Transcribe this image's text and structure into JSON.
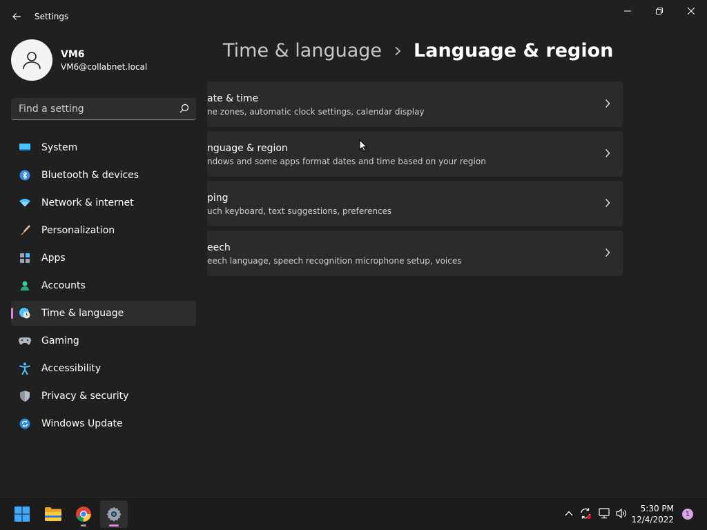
{
  "window": {
    "title": "Settings"
  },
  "profile": {
    "name": "VM6",
    "email": "VM6@collabnet.local"
  },
  "search": {
    "placeholder": "Find a setting"
  },
  "sidebar": {
    "items": [
      {
        "label": "System",
        "icon": "monitor-icon"
      },
      {
        "label": "Bluetooth & devices",
        "icon": "bluetooth-icon"
      },
      {
        "label": "Network & internet",
        "icon": "wifi-icon"
      },
      {
        "label": "Personalization",
        "icon": "brush-icon"
      },
      {
        "label": "Apps",
        "icon": "apps-icon"
      },
      {
        "label": "Accounts",
        "icon": "person-icon"
      },
      {
        "label": "Time & language",
        "icon": "globe-clock-icon",
        "selected": true
      },
      {
        "label": "Gaming",
        "icon": "gamepad-icon"
      },
      {
        "label": "Accessibility",
        "icon": "accessibility-icon"
      },
      {
        "label": "Privacy & security",
        "icon": "shield-icon"
      },
      {
        "label": "Windows Update",
        "icon": "update-icon"
      }
    ]
  },
  "breadcrumb": {
    "parent": "Time & language",
    "current": "Language & region"
  },
  "cards": [
    {
      "title": "ate & time",
      "desc": "ne zones, automatic clock settings, calendar display"
    },
    {
      "title": "nguage & region",
      "desc": "ndows and some apps format dates and time based on your region"
    },
    {
      "title": "ping",
      "desc": "uch keyboard, text suggestions, preferences"
    },
    {
      "title": "eech",
      "desc": "eech language, speech recognition microphone setup, voices"
    }
  ],
  "taskbar": {
    "time": "5:30 PM",
    "date": "12/4/2022",
    "notifications": "1"
  },
  "colors": {
    "accent": "#d98ad9",
    "background": "#202020",
    "card": "#2b2b2b"
  }
}
